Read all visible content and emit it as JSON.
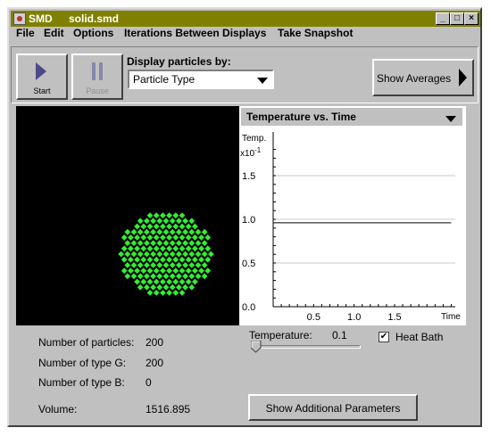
{
  "window": {
    "app_title": "SMD",
    "file_title": "solid.smd",
    "minimize": "_",
    "maximize": "□",
    "close": "×"
  },
  "menu": [
    "File",
    "Edit",
    "Options",
    "Iterations Between Displays",
    "Take Snapshot"
  ],
  "toolbar": {
    "start_label": "Start",
    "pause_label": "Pause",
    "display_by_label": "Display particles by:",
    "display_by_value": "Particle Type",
    "show_averages_label": "Show Averages"
  },
  "graph": {
    "selector_value": "Temperature vs. Time",
    "chart_data": {
      "type": "line",
      "title": "",
      "ylabel": "Temp.",
      "y_multiplier": "x10-1",
      "xlabel": "Time",
      "xlim": [
        0,
        2.25
      ],
      "ylim": [
        0,
        2.0
      ],
      "xticks": [
        "0.5",
        "1.0",
        "1.5"
      ],
      "yticks": [
        "0.0",
        "0.5",
        "1.0",
        "1.5"
      ],
      "grid": true,
      "series": [
        {
          "x": [
            0.0,
            2.2
          ],
          "y": [
            0.96,
            0.96
          ]
        }
      ]
    }
  },
  "particles": {
    "color": "#33ee33",
    "count_shown": 200
  },
  "params": {
    "num_particles_label": "Number of particles:",
    "num_particles_value": "200",
    "type_g_label": "Number of type G:",
    "type_g_value": "200",
    "type_b_label": "Number of type B:",
    "type_b_value": "0",
    "volume_label": "Volume:",
    "volume_value": "1516.895",
    "temperature_label": "Temperature:",
    "temperature_value": "0.1",
    "temperature_slider_fraction": 0.02,
    "heat_bath_label": "Heat Bath",
    "heat_bath_checked": "✔",
    "show_additional_label": "Show Additional Parameters"
  }
}
